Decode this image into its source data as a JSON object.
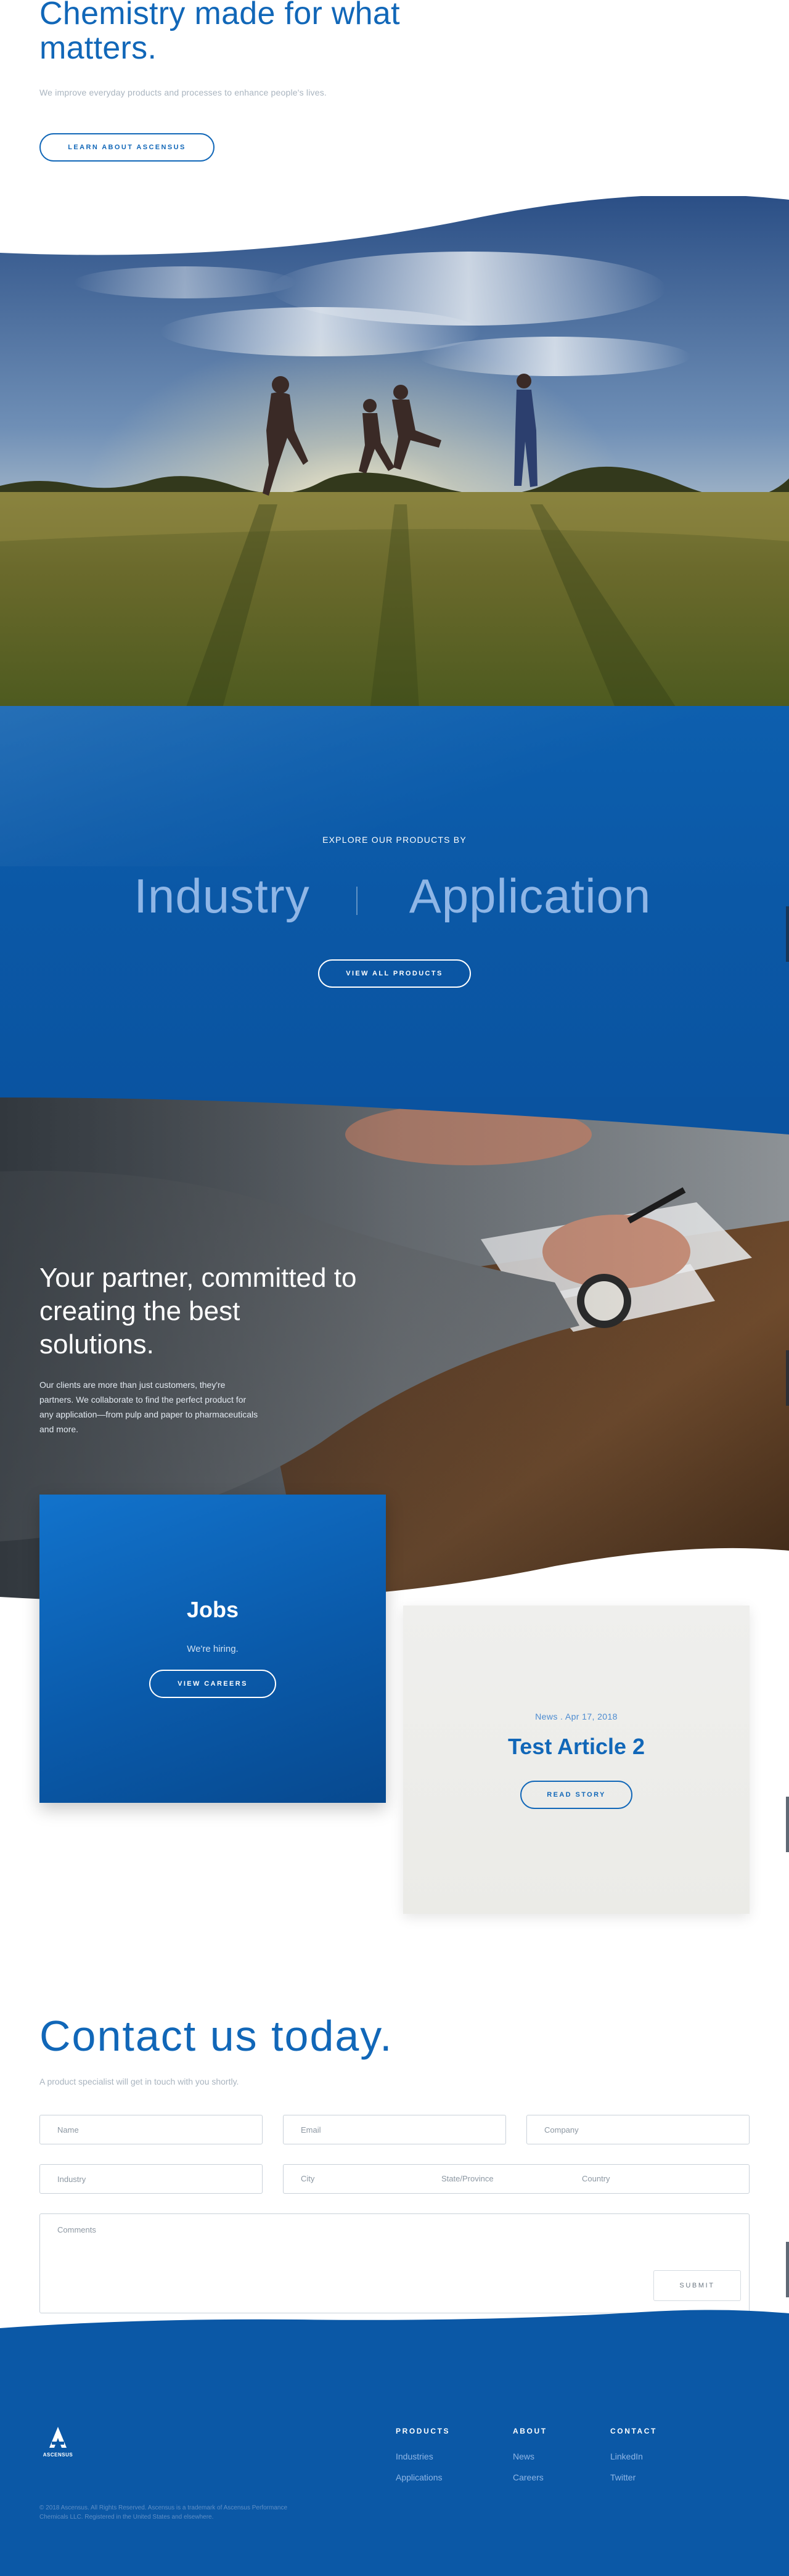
{
  "hero": {
    "title": "Chemistry made for what matters.",
    "subtitle": "We improve everyday products and processes to enhance people's lives.",
    "cta_label": "LEARN ABOUT ASCENSUS"
  },
  "products": {
    "explore_label": "EXPLORE OUR PRODUCTS BY",
    "categories": [
      "Industry",
      "Application"
    ],
    "cta_label": "VIEW ALL PRODUCTS"
  },
  "partner": {
    "title": "Your partner, committed to creating the best solutions.",
    "description": "Our clients are more than just customers, they're partners. We collaborate to find the perfect product for any application—from pulp and paper to pharmaceuticals and more."
  },
  "jobs_card": {
    "title": "Jobs",
    "subtitle": "We're hiring.",
    "cta_label": "VIEW CAREERS"
  },
  "news_card": {
    "meta": "News . Apr 17, 2018",
    "title": "Test Article 2",
    "cta_label": "READ STORY"
  },
  "contact": {
    "title": "Contact us today.",
    "subtitle": "A product specialist will get in touch with you shortly.",
    "placeholders": {
      "name": "Name",
      "email": "Email",
      "company": "Company",
      "industry": "Industry",
      "city": "City",
      "state": "State/Province",
      "country": "Country",
      "comments": "Comments"
    },
    "submit_label": "SUBMIT"
  },
  "footer": {
    "logo_text": "ASCENSUS",
    "columns": [
      {
        "heading": "PRODUCTS",
        "links": [
          "Industries",
          "Applications"
        ]
      },
      {
        "heading": "ABOUT",
        "links": [
          "News",
          "Careers"
        ]
      },
      {
        "heading": "CONTACT",
        "links": [
          "LinkedIn",
          "Twitter"
        ]
      }
    ],
    "legal": "© 2018 Ascensus. All Rights Reserved. Ascensus is a trademark of Ascensus Performance Chemicals LLC. Registered in the United States and elsewhere."
  },
  "colors": {
    "brand_blue": "#1167b8",
    "band_blue": "#0b58a6",
    "light_blue_text": "#8fb6e6",
    "muted_text": "#a9b4bf"
  }
}
